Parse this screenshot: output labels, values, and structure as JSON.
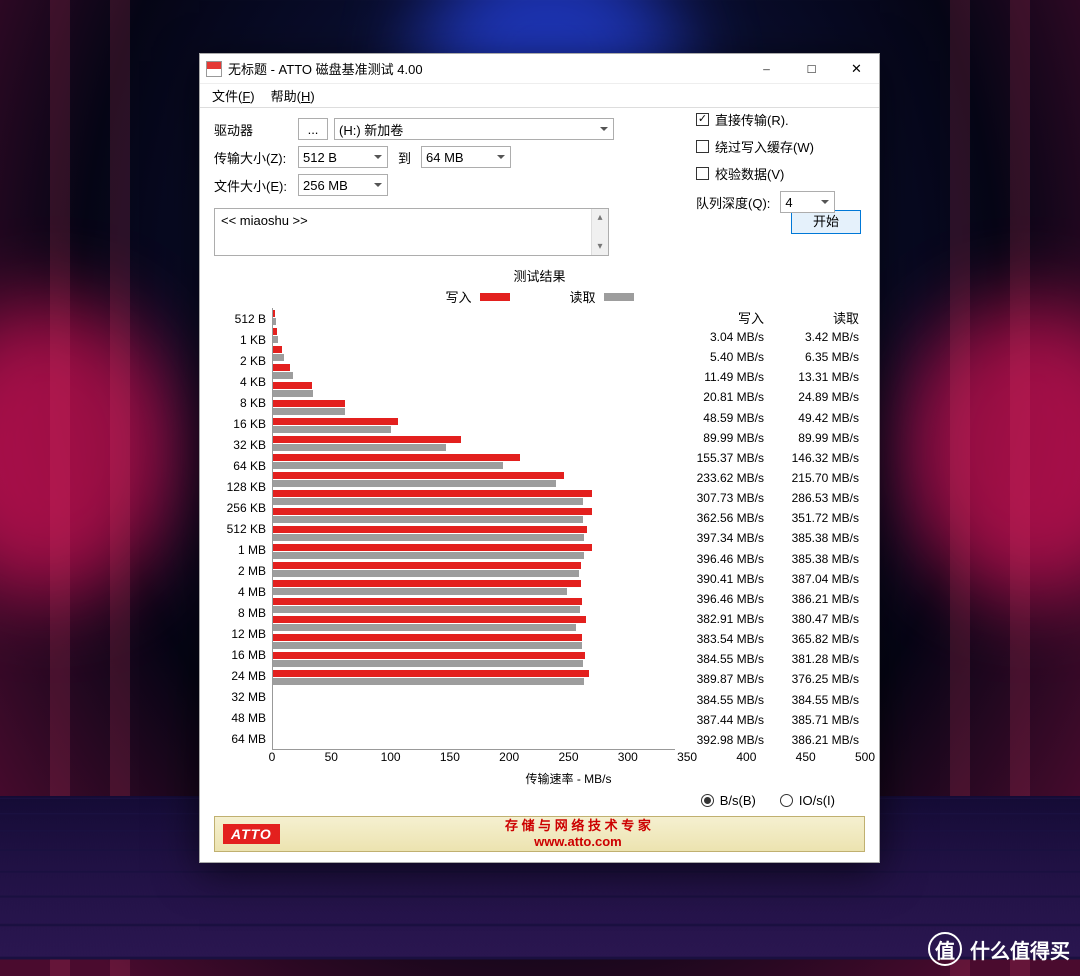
{
  "window": {
    "title": "无标题 - ATTO 磁盘基准测试 4.00"
  },
  "menu": {
    "file": "文件(F)",
    "help": "帮助(H)"
  },
  "form": {
    "drive_label": "驱动器",
    "drive_value": "(H:) 新加卷",
    "tsize_label": "传输大小(Z):",
    "tsize_from": "512 B",
    "tsize_to_label": "到",
    "tsize_to": "64 MB",
    "fsize_label": "文件大小(E):",
    "fsize_value": "256 MB",
    "direct_io": "直接传输(R).",
    "bypass_cache": "绕过写入缓存(W)",
    "verify": "校验数据(V)",
    "queue_depth_label": "队列深度(Q):",
    "queue_depth_value": "4",
    "direct_io_checked": true,
    "bypass_cache_checked": false,
    "verify_checked": false
  },
  "description": "<< miaoshu >>",
  "start_button": "开始",
  "results": {
    "title": "测试结果",
    "legend_write": "写入",
    "legend_read": "读取",
    "xlabel": "传输速率 - MB/s",
    "xticks": [
      "0",
      "50",
      "100",
      "150",
      "200",
      "250",
      "300",
      "350",
      "400",
      "450",
      "500"
    ],
    "header_write": "写入",
    "header_read": "读取",
    "unit": "MB/s"
  },
  "radios": {
    "bs": "B/s(B)",
    "ios": "IO/s(I)"
  },
  "footer": {
    "logo": "ATTO",
    "text1": "存 储 与 网 络 技 术 专 家",
    "text2": "www.atto.com"
  },
  "watermark": "什么值得买",
  "chart_data": {
    "type": "bar",
    "orientation": "horizontal",
    "xlabel": "传输速率 - MB/s",
    "xlim": [
      0,
      500
    ],
    "categories": [
      "512 B",
      "1 KB",
      "2 KB",
      "4 KB",
      "8 KB",
      "16 KB",
      "32 KB",
      "64 KB",
      "128 KB",
      "256 KB",
      "512 KB",
      "1 MB",
      "2 MB",
      "4 MB",
      "8 MB",
      "12 MB",
      "16 MB",
      "24 MB",
      "32 MB",
      "48 MB",
      "64 MB"
    ],
    "series": [
      {
        "name": "写入",
        "color": "#e3201e",
        "values": [
          3.04,
          5.4,
          11.49,
          20.81,
          48.59,
          89.99,
          155.37,
          233.62,
          307.73,
          362.56,
          397.34,
          396.46,
          390.41,
          396.46,
          382.91,
          383.54,
          384.55,
          389.87,
          384.55,
          387.44,
          392.98
        ]
      },
      {
        "name": "读取",
        "color": "#9d9d9d",
        "values": [
          3.42,
          6.35,
          13.31,
          24.89,
          49.42,
          89.99,
          146.32,
          215.7,
          286.53,
          351.72,
          385.38,
          385.38,
          387.04,
          386.21,
          380.47,
          365.82,
          381.28,
          376.25,
          384.55,
          385.71,
          386.21
        ]
      }
    ]
  }
}
